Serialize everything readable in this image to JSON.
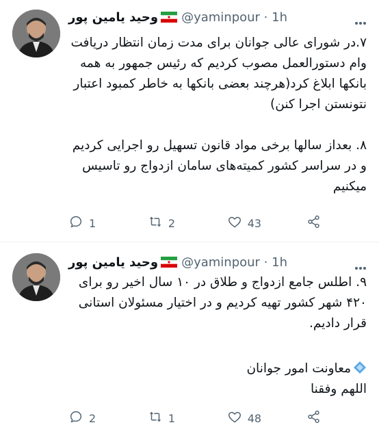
{
  "tweets": [
    {
      "author_name": "وحید یامین پور",
      "handle": "@yaminpour",
      "sep": "·",
      "time": "1h",
      "text": "۷.در شورای عالی جوانان برای مدت زمان انتظار دریافت وام دستورالعمل مصوب کردیم که رئیس جمهور به همه بانکها ابلاغ کرد(هرچند بعضی بانکها به خاطر کمبود اعتبار نتونستن اجرا کنن)\n\n۸. بعداز سالها برخی مواد قانون تسهیل رو اجرایی کردیم و در سراسر کشور کمیته‌های سامان ازدواج رو تاسیس میکنیم",
      "reply_count": "1",
      "retweet_count": "2",
      "like_count": "43"
    },
    {
      "author_name": "وحید یامین پور",
      "handle": "@yaminpour",
      "sep": "·",
      "time": "1h",
      "text_main": "۹. اطلس جامع ازدواج و طلاق در ۱۰ سال اخیر رو برای ۴۲۰ شهر کشور تهیه کردیم و در اختیار مسئولان استانی قرار دادیم.",
      "signature": "معاونت امور جوانان",
      "closing": "اللهم وفقنا",
      "reply_count": "2",
      "retweet_count": "1",
      "like_count": "48"
    }
  ],
  "icons": {
    "flag": "iran-flag-icon",
    "more": "more-dots-icon",
    "reply": "reply-icon",
    "retweet": "retweet-icon",
    "like": "heart-icon",
    "share": "share-icon",
    "diamond": "blue-diamond-icon"
  },
  "colors": {
    "secondary": "#536471",
    "text": "#0f1419",
    "divider": "#eff3f4"
  }
}
